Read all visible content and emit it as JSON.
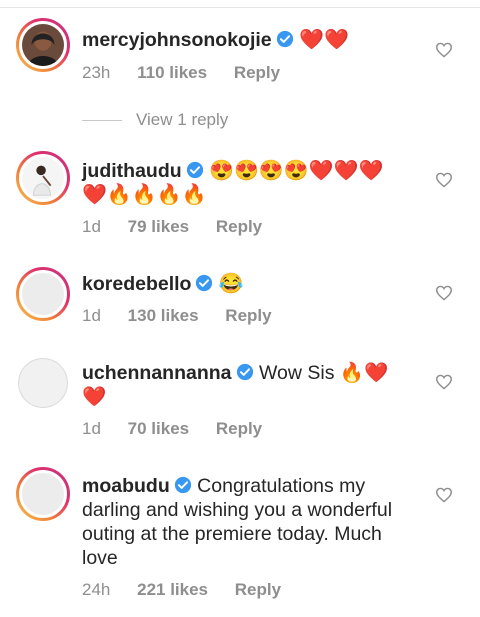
{
  "comments": [
    {
      "username": "mercyjohnsonokojie",
      "text": "❤️❤️",
      "time": "23h",
      "likes": "110 likes",
      "reply": "Reply",
      "view_replies": "View 1 reply"
    },
    {
      "username": "judithaudu",
      "text": "😍😍😍😍❤️❤️❤️\n❤️🔥🔥🔥🔥",
      "time": "1d",
      "likes": "79 likes",
      "reply": "Reply"
    },
    {
      "username": "koredebello",
      "text": "😂",
      "time": "1d",
      "likes": "130 likes",
      "reply": "Reply"
    },
    {
      "username": "uchennannanna",
      "text": "Wow Sis 🔥❤️\n❤️",
      "time": "1d",
      "likes": "70 likes",
      "reply": "Reply"
    },
    {
      "username": "moabudu",
      "text": "Congratulations my darling and wishing you a wonderful outing at the premiere today. Much love",
      "time": "24h",
      "likes": "221 likes",
      "reply": "Reply"
    }
  ],
  "colors": {
    "verified": "#3897f0",
    "meta": "#8e8e8e",
    "text": "#262626"
  },
  "icons": {
    "verified": "verified-badge-icon",
    "like": "heart-outline-icon"
  }
}
